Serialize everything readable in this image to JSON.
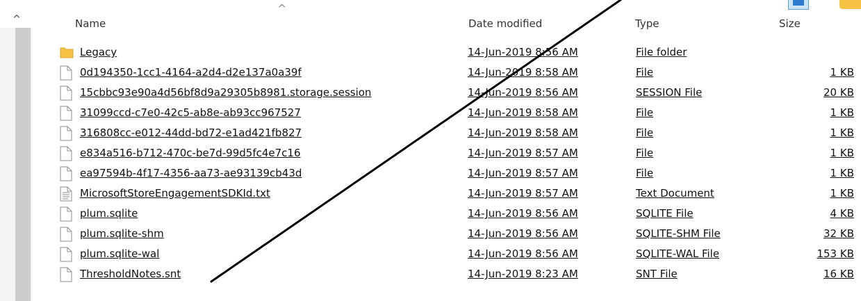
{
  "header": {
    "name": "Name",
    "date_modified": "Date modified",
    "type": "Type",
    "size": "Size"
  },
  "files": [
    {
      "name": "Legacy",
      "date": "14-Jun-2019 8:56 AM",
      "type": "File folder",
      "size": "",
      "icon": "folder-icon"
    },
    {
      "name": "0d194350-1cc1-4164-a2d4-d2e137a0a39f",
      "date": "14-Jun-2019 8:58 AM",
      "type": "File",
      "size": "1 KB",
      "icon": "file-icon"
    },
    {
      "name": "15cbbc93e90a4d56bf8d9a29305b8981.storage.session",
      "date": "14-Jun-2019 8:56 AM",
      "type": "SESSION File",
      "size": "20 KB",
      "icon": "file-icon"
    },
    {
      "name": "31099ccd-c7e0-42c5-ab8e-ab93cc967527",
      "date": "14-Jun-2019 8:58 AM",
      "type": "File",
      "size": "1 KB",
      "icon": "file-icon"
    },
    {
      "name": "316808cc-e012-44dd-bd72-e1ad421fb827",
      "date": "14-Jun-2019 8:58 AM",
      "type": "File",
      "size": "1 KB",
      "icon": "file-icon"
    },
    {
      "name": "e834a516-b712-470c-be7d-99d5fc4e7c16",
      "date": "14-Jun-2019 8:57 AM",
      "type": "File",
      "size": "1 KB",
      "icon": "file-icon"
    },
    {
      "name": "ea97594b-4f17-4356-aa73-ae93139cb43d",
      "date": "14-Jun-2019 8:57 AM",
      "type": "File",
      "size": "1 KB",
      "icon": "file-icon"
    },
    {
      "name": "MicrosoftStoreEngagementSDKId.txt",
      "date": "14-Jun-2019 8:57 AM",
      "type": "Text Document",
      "size": "1 KB",
      "icon": "text-document-icon"
    },
    {
      "name": "plum.sqlite",
      "date": "14-Jun-2019 8:56 AM",
      "type": "SQLITE File",
      "size": "4 KB",
      "icon": "file-icon"
    },
    {
      "name": "plum.sqlite-shm",
      "date": "14-Jun-2019 8:56 AM",
      "type": "SQLITE-SHM File",
      "size": "32 KB",
      "icon": "file-icon"
    },
    {
      "name": "plum.sqlite-wal",
      "date": "14-Jun-2019 8:56 AM",
      "type": "SQLITE-WAL File",
      "size": "153 KB",
      "icon": "file-icon"
    },
    {
      "name": "ThresholdNotes.snt",
      "date": "14-Jun-2019 8:23 AM",
      "type": "SNT File",
      "size": "16 KB",
      "icon": "file-icon"
    }
  ],
  "icons": {
    "scroll_up": "scroll-up-arrow-icon",
    "sort": "sort-ascending-icon",
    "view_details": "details-view-icon",
    "view_folder": "folder-view-icon"
  },
  "colors": {
    "background": "#ffffff",
    "scrollbar_thumb": "#cdcdcd",
    "folder": "#f5c243",
    "view_accent": "#2b7bd0",
    "annotation_line": "#000000"
  }
}
